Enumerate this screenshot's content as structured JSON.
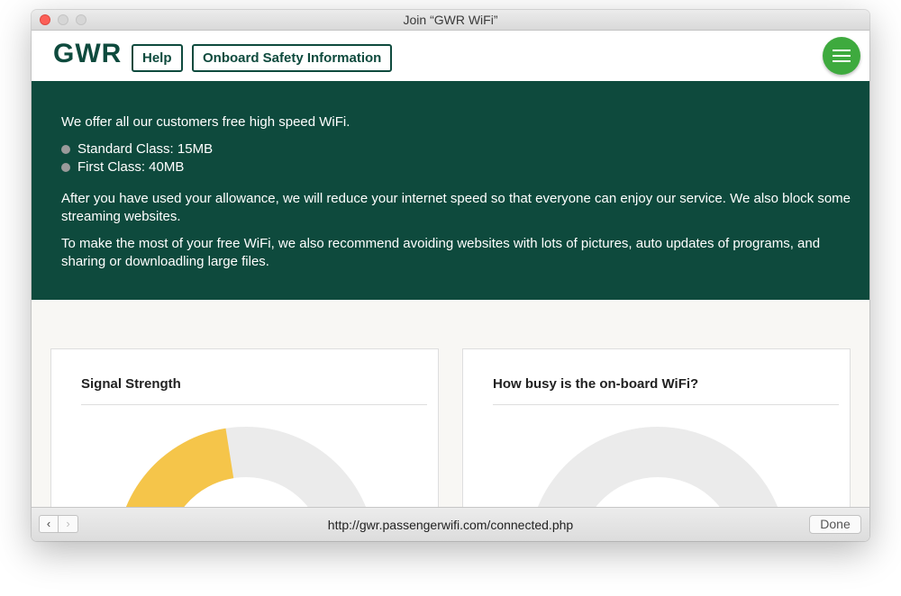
{
  "window": {
    "title": "Join “GWR WiFi”"
  },
  "header": {
    "logo": "GWR",
    "nav": {
      "help": "Help",
      "safety": "Onboard Safety Information"
    },
    "menu_icon": "hamburger-icon",
    "accent_color": "#3eaa3e",
    "brand_color": "#0e4a3d"
  },
  "banner": {
    "intro": "We offer all our customers free high speed WiFi.",
    "bullets": [
      "Standard Class: 15MB",
      "First Class: 40MB"
    ],
    "para2": "After you have used your allowance, we will reduce your internet speed so that everyone can enjoy our service. We also block some streaming websites.",
    "para3": "To make the most of your free WiFi, we also recommend avoiding websites with lots of pictures, auto updates of programs, and sharing or downloadling large files."
  },
  "cards": {
    "signal": {
      "title": "Signal Strength",
      "level": 0.45,
      "fill_color": "#f5c54a",
      "track_color": "#ebebeb"
    },
    "busy": {
      "title": "How busy is the on-board WiFi?",
      "level": 0,
      "fill_color": "#3eaa3e",
      "track_color": "#ebebeb"
    }
  },
  "bottombar": {
    "back_icon": "chevron-left-icon",
    "forward_icon": "chevron-right-icon",
    "url": "http://gwr.passengerwifi.com/connected.php",
    "done": "Done"
  }
}
